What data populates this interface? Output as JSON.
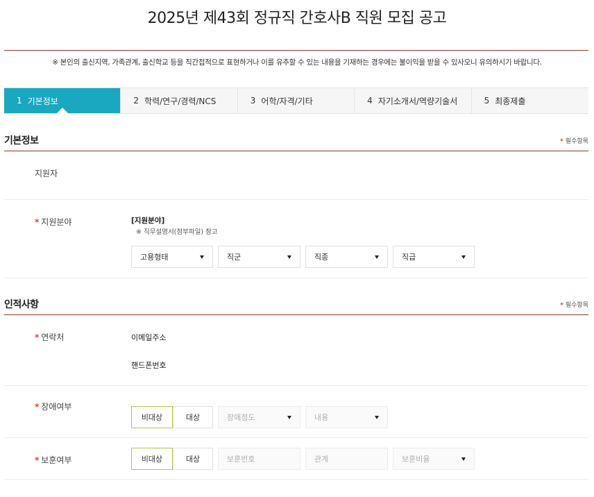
{
  "page": {
    "title": "2025년 제43회 정규직 간호사B 직원 모집 공고",
    "notice": "※ 본인의 출신지역, 가족관계, 출신학교 등을 직간접적으로 표현하거나 이를 유추할 수 있는 내용을 기재하는 경우에는 불이익을 받을 수 있사오니 유의하시기 바랍니다."
  },
  "tabs": [
    {
      "num": "1",
      "label": "기본정보",
      "active": true
    },
    {
      "num": "2",
      "label": "학력/연구/경력/NCS",
      "active": false
    },
    {
      "num": "3",
      "label": "어학/자격/기타",
      "active": false
    },
    {
      "num": "4",
      "label": "자기소개서/역량기술서",
      "active": false
    },
    {
      "num": "5",
      "label": "최종제출",
      "active": false
    }
  ],
  "basic": {
    "section_title": "기본정보",
    "required_note": "필수항목",
    "applicant_label": "지원자",
    "field_label": "지원분야",
    "field_heading": "[지원분야]",
    "field_hint": "※ 직무설명서(첨부파일) 참고",
    "selects": {
      "employment_type": "고용형태",
      "job_group": "직군",
      "job_type": "직종",
      "job_grade": "직급"
    }
  },
  "personal": {
    "section_title": "인적사항",
    "required_note": "필수항목",
    "contact_label": "연락처",
    "email_label": "이메일주소",
    "phone_label": "핸드폰번호",
    "disability_label": "장애여부",
    "disability": {
      "not_applicable": "비대상",
      "applicable": "대상",
      "degree_placeholder": "장애정도",
      "content_placeholder": "내용"
    },
    "veteran_label": "보훈여부",
    "veteran": {
      "not_applicable": "비대상",
      "applicable": "대상",
      "number_placeholder": "보훈번호",
      "relation_placeholder": "관계",
      "ratio_placeholder": "보훈비율"
    }
  },
  "colors": {
    "accent": "#1aa7c0",
    "rule": "#8b3a2a",
    "required_star": "#d9432c",
    "toggle_selected_border": "#b9c14a"
  },
  "icons": {
    "required": "asterisk-icon",
    "dropdown": "caret-down-icon"
  }
}
